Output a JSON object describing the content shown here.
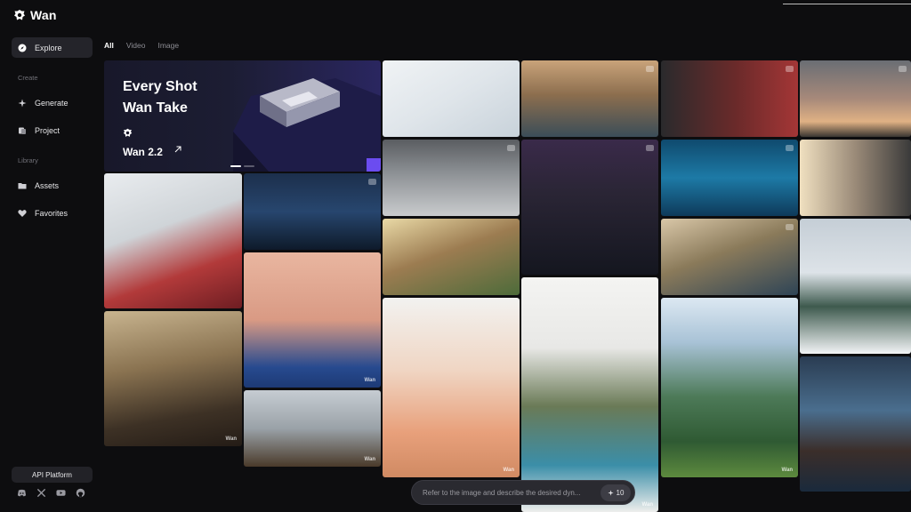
{
  "app": {
    "name": "Wan",
    "logo_icon": "wan-logo-icon"
  },
  "sidebar": {
    "explore": {
      "label": "Explore",
      "icon": "compass-icon"
    },
    "create_label": "Create",
    "generate": {
      "label": "Generate",
      "icon": "sparkle-icon"
    },
    "project": {
      "label": "Project",
      "icon": "project-icon"
    },
    "library_label": "Library",
    "assets": {
      "label": "Assets",
      "icon": "folder-icon"
    },
    "favorites": {
      "label": "Favorites",
      "icon": "heart-icon"
    },
    "api_platform": "API Platform",
    "socials": [
      "discord-icon",
      "x-icon",
      "youtube-icon",
      "github-icon"
    ]
  },
  "tabs": [
    {
      "label": "All",
      "active": true
    },
    {
      "label": "Video",
      "active": false
    },
    {
      "label": "Image",
      "active": false
    }
  ],
  "hero": {
    "title": "Every Shot\nWan Take",
    "version": "Wan 2.2",
    "arrow_icon": "arrow-up-right-icon"
  },
  "watermark": "Wan",
  "prompt": {
    "placeholder": "Refer to the image and describe the desired dyn...",
    "credits": "10",
    "credit_icon": "sparkle-icon"
  },
  "colors": {
    "background": "#0d0d0f",
    "active_nav": "#24242a",
    "prompt_bg": "#2a2a30"
  }
}
